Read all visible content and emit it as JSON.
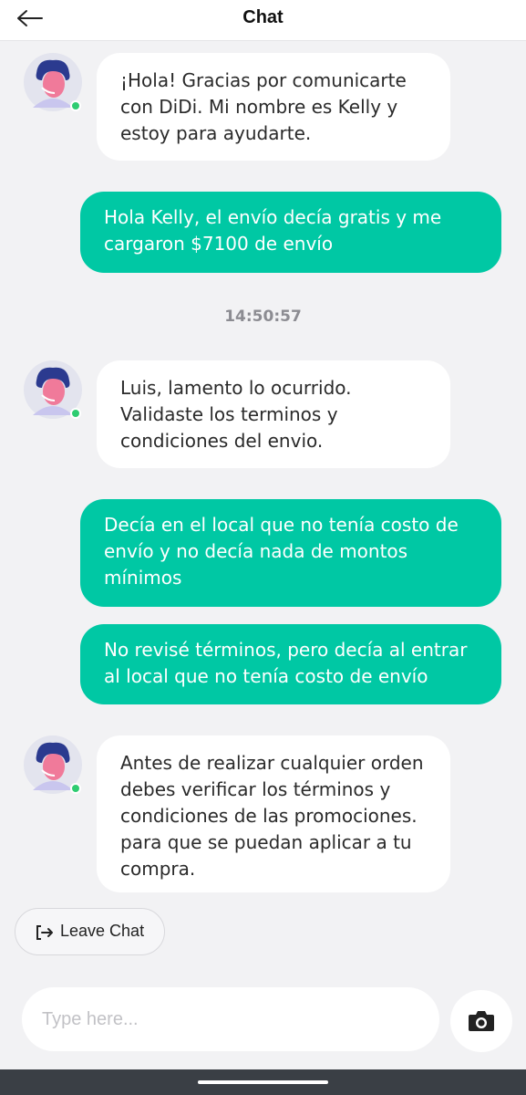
{
  "header": {
    "title": "Chat"
  },
  "messages": [
    {
      "sender": "agent",
      "text": "¡Hola! Gracias por comunicarte con DiDi. Mi nombre es Kelly y estoy para ayudarte."
    },
    {
      "sender": "user",
      "text": "Hola Kelly, el envío decía gratis y me cargaron $7100 de envío"
    },
    {
      "sender": "timestamp",
      "text": "14:50:57"
    },
    {
      "sender": "agent",
      "text": "Luis, lamento lo ocurrido. Validaste los terminos y condiciones del envio."
    },
    {
      "sender": "user",
      "text": "Decía en el local que no tenía costo de envío y no decía nada de montos mínimos"
    },
    {
      "sender": "user",
      "text": "No revisé términos, pero decía al entrar al local que no tenía costo de envío"
    },
    {
      "sender": "agent",
      "text": "Antes de realizar cualquier orden debes verificar los términos y condiciones de las promociones. para que se puedan aplicar a tu compra."
    }
  ],
  "leave_chat": {
    "label": "Leave Chat",
    "icon": "exit-icon"
  },
  "composer": {
    "placeholder": "Type here...",
    "camera_icon": "camera-icon"
  },
  "colors": {
    "user_bubble": "#00c8a4",
    "agent_bubble": "#ffffff",
    "background": "#f2f2f4",
    "online": "#2ecc71"
  }
}
